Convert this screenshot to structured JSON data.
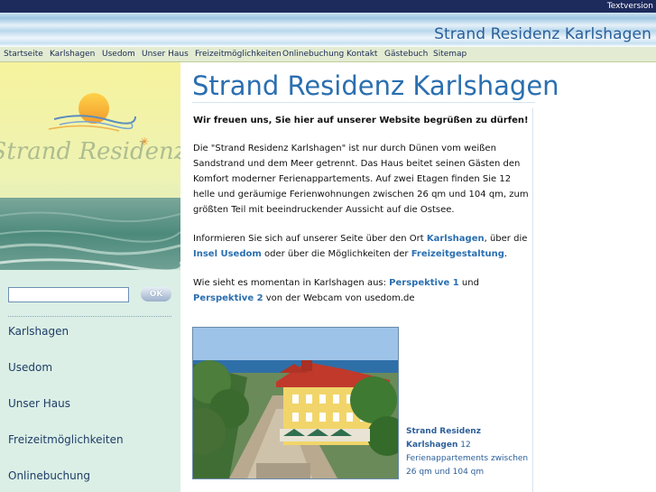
{
  "header": {
    "textversion_label": "Textversion",
    "site_title": "Strand Residenz Karlshagen"
  },
  "topnav": {
    "items": [
      "Startseite",
      "Karlshagen",
      "Usedom",
      "Unser Haus",
      "Freizeitmöglichkeiten",
      "Onlinebuchung",
      "Kontakt",
      "Gästebuch",
      "Sitemap"
    ]
  },
  "sidebar": {
    "logo_text": "Strand Residenz",
    "search": {
      "value": "",
      "placeholder": ""
    },
    "ok_label": "OK",
    "links": [
      "Karlshagen",
      "Usedom",
      "Unser Haus",
      "Freizeitmöglichkeiten",
      "Onlinebuchung"
    ]
  },
  "content": {
    "title": "Strand Residenz Karlshagen",
    "welcome": "Wir freuen uns, Sie hier auf unserer Website begrüßen zu dürfen!",
    "intro": "Die \"Strand Residenz Karlshagen\" ist nur durch Dünen vom weißen Sandstrand und dem Meer getrennt. Das Haus beitet seinen Gästen den Komfort moderner Ferienappartements. Auf zwei Etagen finden Sie 12 helle und geräumige Ferienwohnungen zwischen 26 qm und 104 qm, zum größten Teil mit beeindruckender Aussicht auf die Ostsee.",
    "info": {
      "text1": "Informieren Sie sich auf unserer Seite über den Ort ",
      "link1": "Karlshagen",
      "text2": ", über die ",
      "link2": "Insel Usedom",
      "text3": " oder über die Möglichkeiten der ",
      "link3": "Freizeitgestaltung",
      "text4": "."
    },
    "webcam": {
      "text1": "Wie sieht es momentan in Karlshagen aus: ",
      "link1": "Perspektive 1",
      "text2": " und ",
      "link2": "Perspektive 2",
      "text3": " von der Webcam von usedom.de"
    },
    "caption": {
      "bold": "Strand Residenz Karlshagen",
      "text": " 12 Ferienappartements zwischen 26 qm und 104 qm"
    }
  },
  "colors": {
    "topbar": "#1d2a5c",
    "title_blue": "#2b6fb0",
    "nav_bg": "#e3ecd2",
    "sidebar_bg": "#dbefe6"
  }
}
